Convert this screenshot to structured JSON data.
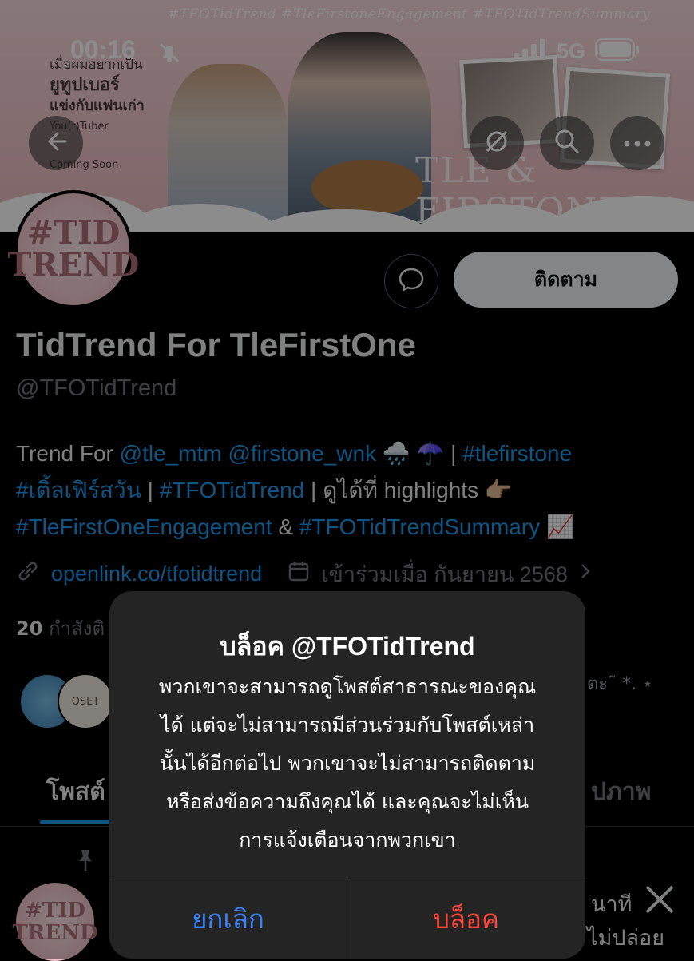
{
  "status_bar": {
    "time": "00:16",
    "network": "5G"
  },
  "banner": {
    "hashtags": "#TFOTidTrend #TleFirstoneEngagement #TFOTidTrendSummary",
    "promo_line1": "เมื่อผมอยากเป็น",
    "promo_line2": "ยูทูปเบอร์",
    "promo_line3": "แข่งกับแฟนเก่า",
    "promo_sub": "You(r)Tuber",
    "coming_soon": "Coming Soon",
    "title": "TLE & FIRSTONE"
  },
  "profile": {
    "avatar_text_1": "#TID",
    "avatar_text_2": "TREND",
    "follow_label": "ติดตาม",
    "display_name": "TidTrend For TleFirstOne",
    "handle": "@TFOTidTrend",
    "bio": {
      "prefix": "Trend For ",
      "mention1": "@tle_mtm",
      "mention2": "@firstone_wnk",
      "emoji1": "🌧️ ☂️",
      "tag1": "#tlefirstone",
      "tag2": "#เติ้ลเฟิร์สวัน",
      "tag3": "#TFOTidTrend",
      "mid": "ดูได้ที่ highlights 👉🏼",
      "tag4": "#TleFirstOneEngagement",
      "amp": "&",
      "tag5": "#TFOTidTrendSummary",
      "emoji2": "📈"
    },
    "link": "openlink.co/tfotidtrend",
    "joined": "เข้าร่วมเมื่อ กันยายน 2568",
    "following_count": "20",
    "following_label": "กำลังติ",
    "mini_avatar_text": "OSET"
  },
  "tabs": {
    "posts": "โพสต์",
    "media_partial": "ปภาพ"
  },
  "background_fragments": {
    "right_snip": "ตะ˜ *. ⋆",
    "right_post1": "นาที",
    "right_post2": "ไม่ปล่อย"
  },
  "alert": {
    "title": "บล็อค @TFOTidTrend",
    "message_lines": [
      "พวกเขาจะสามารถดูโพสต์สาธารณะของคุณ",
      "ได้ แต่จะไม่สามารถมีส่วนร่วมกับโพสต์เหล่า",
      "นั้นได้อีกต่อไป พวกเขาจะไม่สามารถติดตาม",
      "หรือส่งข้อความถึงคุณได้ และคุณจะไม่เห็น",
      "การแจ้งเตือนจากพวกเขา"
    ],
    "cancel_label": "ยกเลิก",
    "block_label": "บล็อค"
  }
}
